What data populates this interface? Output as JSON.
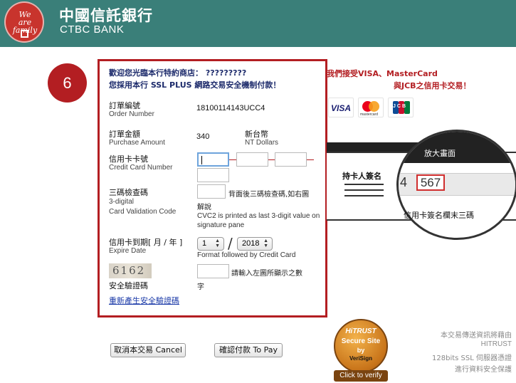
{
  "header": {
    "bank_name_cn": "中國信託銀行",
    "bank_name_en": "CTBC BANK",
    "logo_text_1": "We",
    "logo_text_2": "are",
    "logo_text_3": "family",
    "background_color": "#3a7f79"
  },
  "step_number": "6",
  "intro": {
    "line1": "歡迎您光臨本行特約商店： ?????????",
    "line2": "您採用本行 SSL PLUS 網路交易安全機制付款！"
  },
  "order_number": {
    "label_cn": "訂單編號",
    "label_en": "Order Number",
    "value": "18100114143UCC4"
  },
  "amount": {
    "label_cn": "訂單金額",
    "label_en": "Purchase Amount",
    "value": "340",
    "currency_cn": "新台幣",
    "currency_en": "NT Dollars"
  },
  "card_number": {
    "label_cn": "信用卡卡號",
    "label_en": "Credit Card Number"
  },
  "cvv": {
    "label_cn": "三碼檢查碼",
    "label_en_1": "3-digital",
    "label_en_2": "Card Validation Code",
    "hint_cn_1": "背面後三碼檢查碼,如右圖",
    "hint_cn_2": "解說",
    "hint_en_1": "CVC2 is printed as last 3-digit value on",
    "hint_en_2": "signature pane"
  },
  "expiry": {
    "label_cn": "信用卡到期[ 月 / 年 ]",
    "label_en": "Expire Date",
    "month": "1",
    "year": "2018",
    "separator": "/",
    "hint": "Format followed by Credit Card"
  },
  "captcha": {
    "image_text": "6162",
    "label_cn": "安全驗證碼",
    "hint_1": "請輸入左圖所顯示之數",
    "hint_2": "字",
    "regenerate_link": "重新產生安全驗證碼"
  },
  "buttons": {
    "cancel": "取消本交易 Cancel",
    "confirm": "確認付款 To Pay"
  },
  "accepted_cards": {
    "line1": "我們接受VISA、MasterCard",
    "line2": "與JCB之信用卡交易！",
    "visa": "VISA",
    "mastercard": "mastercard",
    "jcb": "JCB"
  },
  "cvv_illustration": {
    "magnify_label": "放大畫面",
    "holder_signature": "持卡人簽名",
    "digit_left": "4",
    "cvv_digits": "567",
    "caption": "信用卡簽名欄末三碼"
  },
  "seal": {
    "brand": "HiTRUST",
    "line1": "Secure Site",
    "line2": "by",
    "line3": "VeriSign",
    "verify": "Click to verify"
  },
  "security_note": [
    "本交易傳送資訊將藉由",
    "HITRUST",
    "128bits SSL 伺服器憑證",
    "進行資料安全保護"
  ],
  "colors": {
    "accent_red": "#b31e22",
    "navy_text": "#1c2a6b",
    "link_blue": "#1b3aa8"
  }
}
